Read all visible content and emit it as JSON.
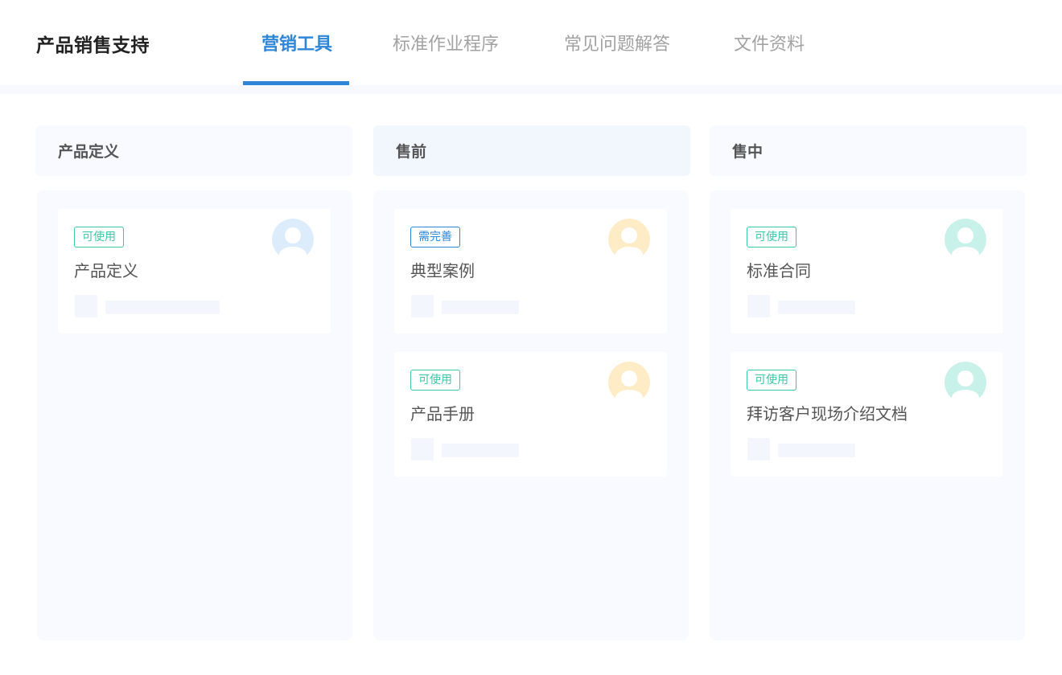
{
  "header": {
    "app_title": "产品销售支持",
    "tabs": [
      {
        "label": "营销工具",
        "active": true
      },
      {
        "label": "标准作业程序",
        "active": false
      },
      {
        "label": "常见问题解答",
        "active": false
      },
      {
        "label": "文件资料",
        "active": false
      }
    ]
  },
  "colors": {
    "accent": "#2f86d8",
    "status_available": "#3ec6a8",
    "status_needs_work": "#2f86d8",
    "avatar_blue": "#dcecfb",
    "avatar_orange": "#fdecc6",
    "avatar_teal": "#c8f1ea"
  },
  "columns": [
    {
      "title": "产品定义",
      "cards": [
        {
          "status": "可使用",
          "title": "产品定义",
          "avatar": "avatar-icon-blue"
        }
      ]
    },
    {
      "title": "售前",
      "cards": [
        {
          "status": "需完善",
          "title": "典型案例",
          "avatar": "avatar-icon-orange"
        },
        {
          "status": "可使用",
          "title": "产品手册",
          "avatar": "avatar-icon-orange"
        }
      ]
    },
    {
      "title": "售中",
      "cards": [
        {
          "status": "可使用",
          "title": "标准合同",
          "avatar": "avatar-icon-teal"
        },
        {
          "status": "可使用",
          "title": "拜访客户现场介绍文档",
          "avatar": "avatar-icon-teal"
        }
      ]
    }
  ]
}
